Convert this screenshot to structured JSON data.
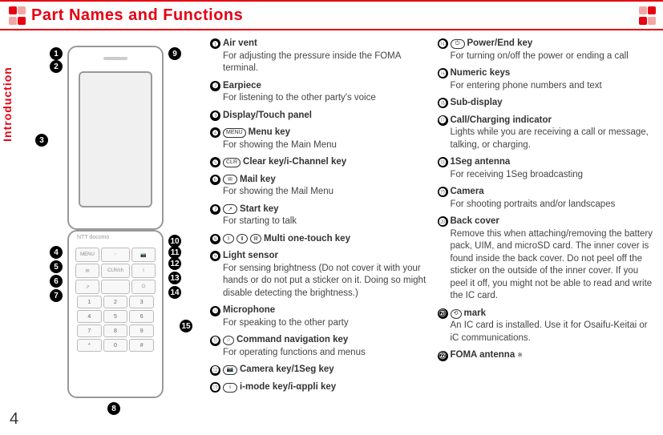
{
  "header": {
    "title": "Part Names and Functions"
  },
  "sideTab": "Introduction",
  "pageNumber": "4",
  "phone": {
    "brand": "NTT docomo"
  },
  "left": [
    {
      "n": "❶",
      "icon": "",
      "title": "Air vent",
      "desc": "For adjusting the pressure inside the FOMA terminal."
    },
    {
      "n": "❷",
      "icon": "",
      "title": "Earpiece",
      "desc": "For listening to the other party's voice"
    },
    {
      "n": "❸",
      "icon": "",
      "title": "Display/Touch panel",
      "desc": ""
    },
    {
      "n": "❹",
      "icon": "MENU",
      "title": "Menu key",
      "desc": "For showing the Main Menu"
    },
    {
      "n": "❺",
      "icon": "CLR",
      "title": "Clear key/i-Channel key",
      "desc": ""
    },
    {
      "n": "❻",
      "icon": "✉",
      "title": "Mail key",
      "desc": "For showing the Mail Menu"
    },
    {
      "n": "❼",
      "icon": "↗",
      "title": "Start key",
      "desc": "For starting to talk"
    },
    {
      "n": "❽",
      "icon": "ⅠⅡⅢ",
      "title": "Multi one-touch key",
      "desc": ""
    },
    {
      "n": "❾",
      "icon": "",
      "title": "Light sensor",
      "desc": "For sensing brightness (Do not cover it with your hands or do not put a sticker on it. Doing so might disable detecting the brightness.)"
    },
    {
      "n": "❿",
      "icon": "",
      "title": "Microphone",
      "desc": "For speaking to the other party"
    },
    {
      "n": "⓫",
      "icon": "○",
      "title": "Command navigation key",
      "desc": "For operating functions and menus"
    },
    {
      "n": "⓬",
      "icon": "📷",
      "title": "Camera key/1Seg key",
      "desc": ""
    },
    {
      "n": "⓭",
      "icon": "i",
      "title": "i-mode key/i-αppli key",
      "desc": ""
    }
  ],
  "right": [
    {
      "n": "⓮",
      "icon": "⏻",
      "title": "Power/End key",
      "desc": "For turning on/off the power or ending a call"
    },
    {
      "n": "⓯",
      "icon": "",
      "title": "Numeric keys",
      "desc": "For entering phone numbers and text"
    },
    {
      "n": "⓰",
      "icon": "",
      "title": "Sub-display",
      "desc": ""
    },
    {
      "n": "⓱",
      "icon": "",
      "title": "Call/Charging indicator",
      "desc": "Lights while you are receiving a call or message, talking, or charging."
    },
    {
      "n": "⓲",
      "icon": "",
      "title": "1Seg antenna",
      "desc": "For receiving 1Seg broadcasting"
    },
    {
      "n": "⓳",
      "icon": "",
      "title": "Camera",
      "desc": "For shooting portraits and/or landscapes"
    },
    {
      "n": "⓴",
      "icon": "",
      "title": "Back cover",
      "desc": "Remove this when attaching/removing the battery pack, UIM, and microSD card. The inner cover is found inside the back cover. Do not peel off the sticker on the outside of the inner cover. If you peel it off, you might not be able to read and write the IC card."
    },
    {
      "n": "㉑",
      "icon": "⟲",
      "title": "mark",
      "desc": "An IC card is installed. Use it for Osaifu-Keitai or iC communications."
    },
    {
      "n": "㉒",
      "icon": "",
      "title": "FOMA antenna",
      "sup": "※",
      "desc": ""
    }
  ]
}
